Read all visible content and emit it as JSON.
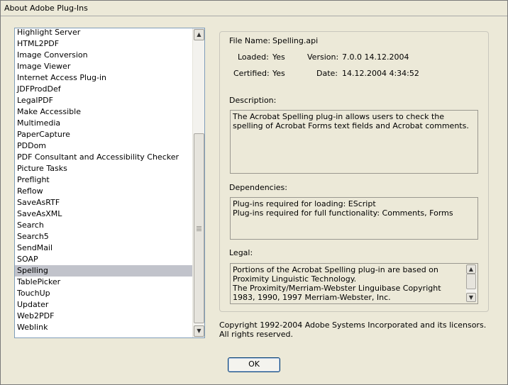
{
  "window": {
    "title": "About Adobe Plug-Ins"
  },
  "plugins": {
    "items": [
      "Highlight Server",
      "HTML2PDF",
      "Image Conversion",
      "Image Viewer",
      "Internet Access Plug-in",
      "JDFProdDef",
      "LegalPDF",
      "Make Accessible",
      "Multimedia",
      "PaperCapture",
      "PDDom",
      "PDF Consultant and Accessibility Checker",
      "Picture Tasks",
      "Preflight",
      "Reflow",
      "SaveAsRTF",
      "SaveAsXML",
      "Search",
      "Search5",
      "SendMail",
      "SOAP",
      "Spelling",
      "TablePicker",
      "TouchUp",
      "Updater",
      "Web2PDF",
      "Weblink"
    ],
    "selected": "Spelling",
    "scroll_up_icon": "▲",
    "scroll_down_icon": "▼"
  },
  "details": {
    "file_name_label": "File Name:",
    "file_name": "Spelling.api",
    "loaded_label": "Loaded:",
    "loaded": "Yes",
    "version_label": "Version:",
    "version": "7.0.0 14.12.2004",
    "certified_label": "Certified:",
    "certified": "Yes",
    "date_label": "Date:",
    "date": "14.12.2004 4:34:52",
    "description_label": "Description:",
    "description": "The Acrobat Spelling plug-in allows users to check the spelling of Acrobat Forms text fields and Acrobat comments.",
    "dependencies_label": "Dependencies:",
    "dependencies_line1": "Plug-ins required for loading: EScript",
    "dependencies_line2": "Plug-ins required for full functionality: Comments, Forms",
    "legal_label": "Legal:",
    "legal_line1": "Portions of the Acrobat Spelling plug-in are based on Proximity Linguistic Technology.",
    "legal_line2": "The Proximity/Merriam-Webster Linguibase Copyright 1983, 1990, 1997 Merriam-Webster, Inc."
  },
  "copyright": "Copyright 1992-2004 Adobe Systems Incorporated and its licensors. All rights reserved.",
  "ok_label": "OK"
}
